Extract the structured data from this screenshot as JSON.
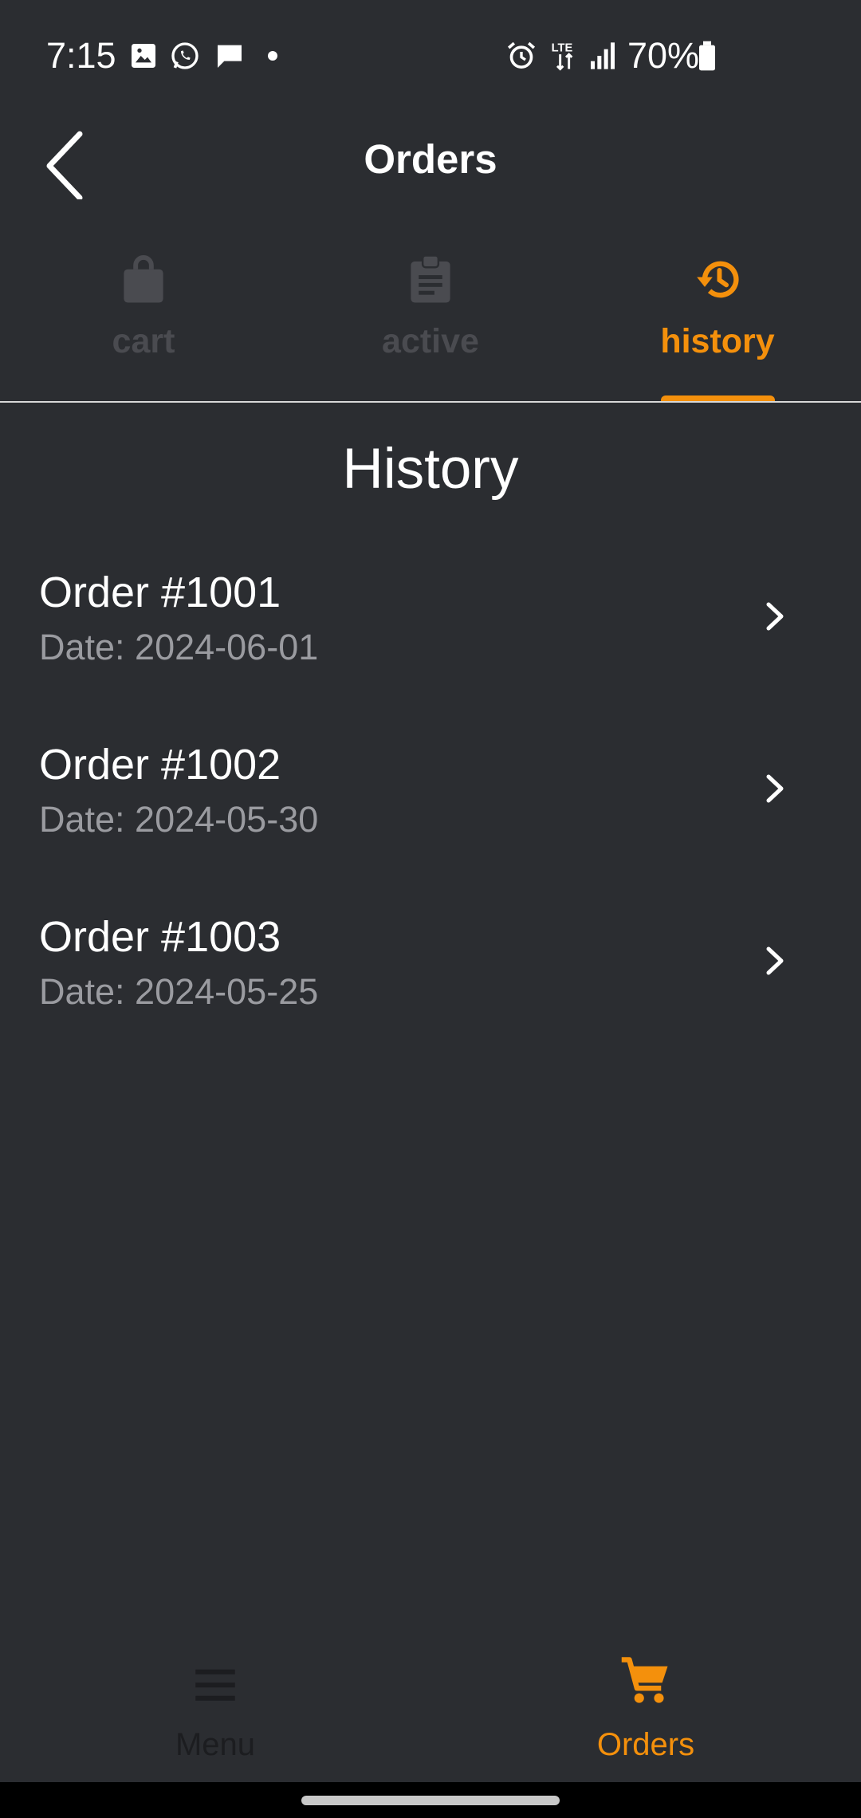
{
  "status_bar": {
    "time": "7:15",
    "battery_percent": "70%",
    "icons": [
      "image-notification-icon",
      "whatsapp-icon",
      "chat-bubble-icon",
      "alarm-icon",
      "lte-data-icon",
      "signal-icon",
      "battery-icon"
    ]
  },
  "app_bar": {
    "title": "Orders",
    "back_icon": "chevron-left-icon"
  },
  "tabs": [
    {
      "label": "cart",
      "icon": "shopping-bag-icon",
      "active": false
    },
    {
      "label": "active",
      "icon": "clipboard-icon",
      "active": false
    },
    {
      "label": "history",
      "icon": "history-icon",
      "active": true
    }
  ],
  "section": {
    "title": "History"
  },
  "orders": [
    {
      "title": "Order #1001",
      "date": "Date: 2024-06-01"
    },
    {
      "title": "Order #1002",
      "date": "Date: 2024-05-30"
    },
    {
      "title": "Order #1003",
      "date": "Date: 2024-05-25"
    }
  ],
  "bottom_nav": [
    {
      "label": "Menu",
      "icon": "hamburger-menu-icon",
      "active": false
    },
    {
      "label": "Orders",
      "icon": "shopping-cart-icon",
      "active": true
    }
  ],
  "colors": {
    "background": "#2b2d31",
    "accent": "#f4900c",
    "inactive": "#4a4b50",
    "secondary_text": "#9a9ba0"
  }
}
